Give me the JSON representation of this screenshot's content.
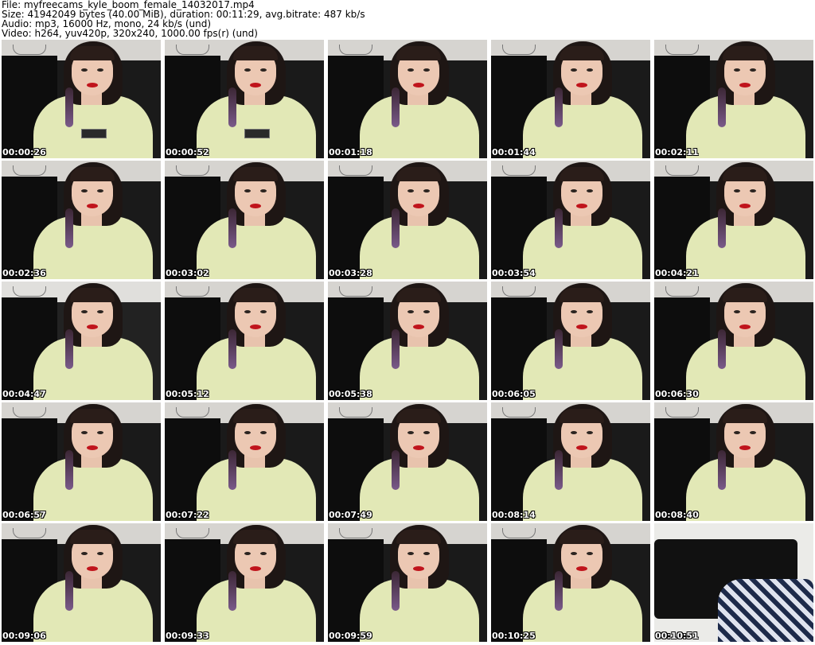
{
  "header": {
    "file": "File: myfreecams_kyle_boom_female_14032017.mp4",
    "size": "Size: 41942049 bytes (40.00 MiB), duration: 00:11:29, avg.bitrate: 487 kb/s",
    "audio": "Audio: mp3, 16000 Hz, mono, 24 kb/s (und)",
    "video": "Video: h264, yuv420p, 320x240, 1000.00 fps(r) (und)"
  },
  "thumbnails": [
    {
      "time": "00:00:26"
    },
    {
      "time": "00:00:52"
    },
    {
      "time": "00:01:18"
    },
    {
      "time": "00:01:44"
    },
    {
      "time": "00:02:11"
    },
    {
      "time": "00:02:36"
    },
    {
      "time": "00:03:02"
    },
    {
      "time": "00:03:28"
    },
    {
      "time": "00:03:54"
    },
    {
      "time": "00:04:21"
    },
    {
      "time": "00:04:47"
    },
    {
      "time": "00:05:12"
    },
    {
      "time": "00:05:38"
    },
    {
      "time": "00:06:05"
    },
    {
      "time": "00:06:30"
    },
    {
      "time": "00:06:57"
    },
    {
      "time": "00:07:22"
    },
    {
      "time": "00:07:49"
    },
    {
      "time": "00:08:14"
    },
    {
      "time": "00:08:40"
    },
    {
      "time": "00:09:06"
    },
    {
      "time": "00:09:33"
    },
    {
      "time": "00:09:59"
    },
    {
      "time": "00:10:25"
    },
    {
      "time": "00:10:51"
    }
  ],
  "colors": {
    "background": "#ffffff",
    "timestamp": "#ffffff",
    "sweater": "#e2e8b6",
    "lips": "#c0141c"
  }
}
